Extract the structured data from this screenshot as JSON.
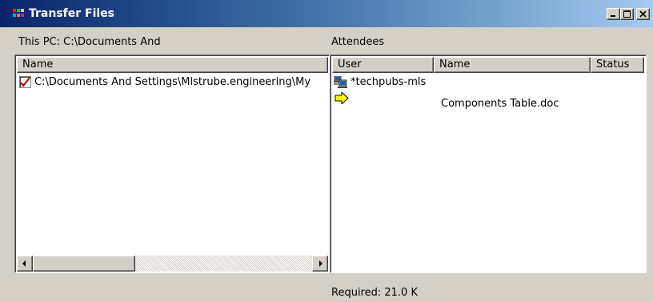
{
  "window": {
    "title": "Transfer Files",
    "app_icon": "transfer-app-icon",
    "controls": [
      "minimize-icon",
      "maximize-icon",
      "close-icon"
    ]
  },
  "left_pane": {
    "label": "This PC:  C:\\Documents And",
    "columns": [
      "Name"
    ],
    "rows": [
      {
        "checked": true,
        "name": "C:\\Documents And Settings\\Mlstrube.engineering\\My"
      }
    ]
  },
  "right_pane": {
    "label": "Attendees",
    "columns": [
      "User",
      "Name",
      "Status"
    ],
    "rows": [
      {
        "icon": "computer-network-icon",
        "user": "*techpubs-mls",
        "name": "",
        "status": ""
      },
      {
        "icon": "arrow-right-icon",
        "user": "",
        "name": "Components Table.doc",
        "status": ""
      }
    ]
  },
  "footer": {
    "required": "Required:  21.0 K"
  }
}
